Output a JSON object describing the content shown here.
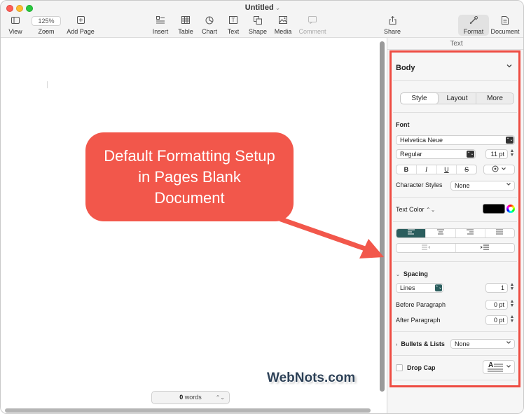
{
  "window": {
    "title": "Untitled",
    "title_chevron": "⌄"
  },
  "toolbar": {
    "view": {
      "label": "View",
      "icon": "sidebar-icon"
    },
    "zoom": {
      "label": "Zoom",
      "value": "125%",
      "chevron": "⌄"
    },
    "add_page": {
      "label": "Add Page",
      "icon": "add-page-icon"
    },
    "insert": {
      "label": "Insert",
      "icon": "insert-icon"
    },
    "table": {
      "label": "Table",
      "icon": "table-icon"
    },
    "chart": {
      "label": "Chart",
      "icon": "chart-icon"
    },
    "text": {
      "label": "Text",
      "icon": "text-box-icon"
    },
    "shape": {
      "label": "Shape",
      "icon": "shape-icon"
    },
    "media": {
      "label": "Media",
      "icon": "media-icon"
    },
    "comment": {
      "label": "Comment",
      "icon": "comment-icon"
    },
    "share": {
      "label": "Share",
      "icon": "share-icon"
    },
    "format": {
      "label": "Format",
      "icon": "paintbrush-icon"
    },
    "document": {
      "label": "Document",
      "icon": "document-icon"
    }
  },
  "canvas": {
    "word_count_value": "0",
    "word_count_label": "words",
    "stepper": "⌃⌄"
  },
  "annotation": {
    "lines": [
      "Default Formatting Setup",
      "in Pages Blank",
      "Document"
    ],
    "color": "#f2574b"
  },
  "watermark": "WebNots.com",
  "inspector": {
    "header": "Text",
    "paragraph_style": "Body",
    "tabs": [
      {
        "label": "Style",
        "active": true
      },
      {
        "label": "Layout",
        "active": false
      },
      {
        "label": "More",
        "active": false
      }
    ],
    "font": {
      "label": "Font",
      "family": "Helvetica Neue",
      "typeface": "Regular",
      "size": "11 pt",
      "bold": "B",
      "italic": "I",
      "underline": "U",
      "strikethrough": "S"
    },
    "character_styles": {
      "label": "Character Styles",
      "value": "None"
    },
    "text_color": {
      "label": "Text Color",
      "value": "#000000",
      "stepper": "⌃⌄"
    },
    "alignment": {
      "active": "left"
    },
    "spacing": {
      "label": "Spacing",
      "mode": "Lines",
      "value": "1",
      "before_label": "Before Paragraph",
      "before_value": "0 pt",
      "after_label": "After Paragraph",
      "after_value": "0 pt"
    },
    "bullets": {
      "label": "Bullets & Lists",
      "value": "None"
    },
    "drop_cap": {
      "label": "Drop Cap",
      "checked": false,
      "preview_letter": "A"
    }
  },
  "colors": {
    "highlight_border": "#ee4c42",
    "align_active": "#2b5e5e",
    "popup_blue": "#2c5f8a"
  }
}
